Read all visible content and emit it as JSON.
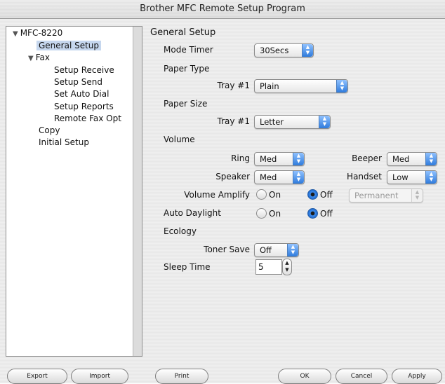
{
  "window": {
    "title": "Brother MFC Remote Setup Program"
  },
  "tree": {
    "items": [
      {
        "label": "MFC-8220",
        "expanded": true
      },
      {
        "label": "General Setup",
        "selected": true
      },
      {
        "label": "Fax",
        "expanded": true
      },
      {
        "label": "Setup Receive"
      },
      {
        "label": "Setup Send"
      },
      {
        "label": "Set Auto Dial"
      },
      {
        "label": "Setup Reports"
      },
      {
        "label": "Remote Fax Opt"
      },
      {
        "label": "Copy"
      },
      {
        "label": "Initial Setup"
      }
    ]
  },
  "panel": {
    "heading": "General Setup",
    "mode_timer": {
      "label": "Mode Timer",
      "value": "30Secs"
    },
    "paper_type": {
      "label": "Paper Type",
      "tray_label": "Tray #1",
      "value": "Plain"
    },
    "paper_size": {
      "label": "Paper Size",
      "tray_label": "Tray #1",
      "value": "Letter"
    },
    "volume": {
      "label": "Volume",
      "ring": {
        "label": "Ring",
        "value": "Med"
      },
      "beeper": {
        "label": "Beeper",
        "value": "Med"
      },
      "speaker": {
        "label": "Speaker",
        "value": "Med"
      },
      "handset": {
        "label": "Handset",
        "value": "Low"
      },
      "amplify": {
        "label": "Volume Amplify",
        "on": "On",
        "off": "Off",
        "selected": "Off",
        "mode": "Permanent",
        "mode_enabled": false
      }
    },
    "auto_daylight": {
      "label": "Auto Daylight",
      "on": "On",
      "off": "Off",
      "selected": "Off"
    },
    "ecology": {
      "label": "Ecology",
      "toner_save": {
        "label": "Toner Save",
        "value": "Off"
      }
    },
    "sleep_time": {
      "label": "Sleep Time",
      "value": "5"
    }
  },
  "buttons": {
    "export": "Export",
    "import": "Import",
    "print": "Print",
    "ok": "OK",
    "cancel": "Cancel",
    "apply": "Apply"
  },
  "icons": {
    "expand": "disclosure-triangle-down",
    "popup": "popup-arrows",
    "stepper": "stepper-arrows"
  },
  "colors": {
    "accent": "#2f7bdc",
    "selection": "#c6d7ee"
  }
}
